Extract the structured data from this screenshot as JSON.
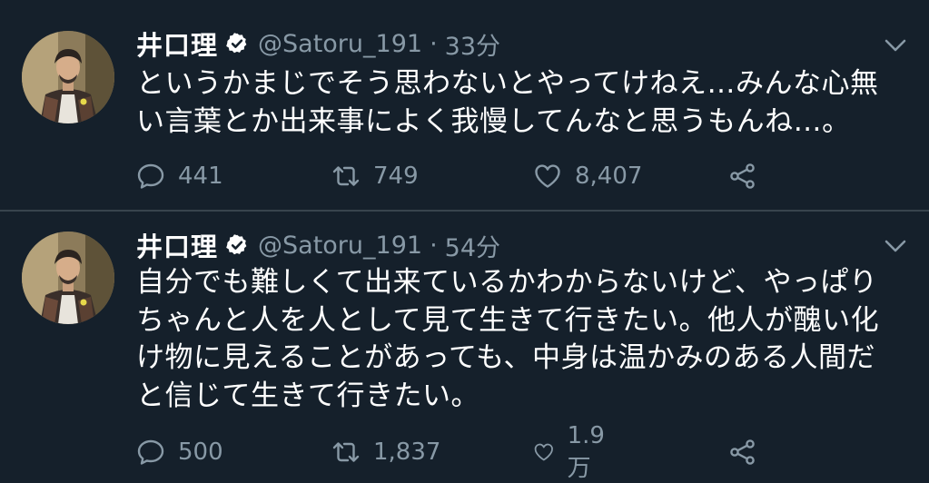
{
  "tweets": [
    {
      "display_name": "井口理",
      "handle": "@Satoru_191",
      "separator": "·",
      "time": "33分",
      "lines": [
        "というかまじでそう思わないとやってけねえ…みんな心無",
        "い言葉とか出来事によく我慢してんなと思うもんね…。"
      ],
      "replies": "441",
      "retweets": "749",
      "likes": "8,407"
    },
    {
      "display_name": "井口理",
      "handle": "@Satoru_191",
      "separator": "·",
      "time": "54分",
      "lines": [
        "自分でも難しくて出来ているかわからないけど、やっぱり",
        "ちゃんと人を人として見て生きて行きたい。他人が醜い化",
        "け物に見えることがあっても、中身は温かみのある人間だ",
        "と信じて生きて行きたい。"
      ],
      "replies": "500",
      "retweets": "1,837",
      "likes": "1.9万"
    }
  ],
  "icons": {
    "verified": "verified-badge-icon",
    "chevron": "chevron-down-icon",
    "reply": "reply-icon",
    "retweet": "retweet-icon",
    "like": "heart-icon",
    "share": "share-icon"
  },
  "colors": {
    "background": "#15202b",
    "secondary_text": "#8899a6",
    "divider": "#38444d"
  }
}
